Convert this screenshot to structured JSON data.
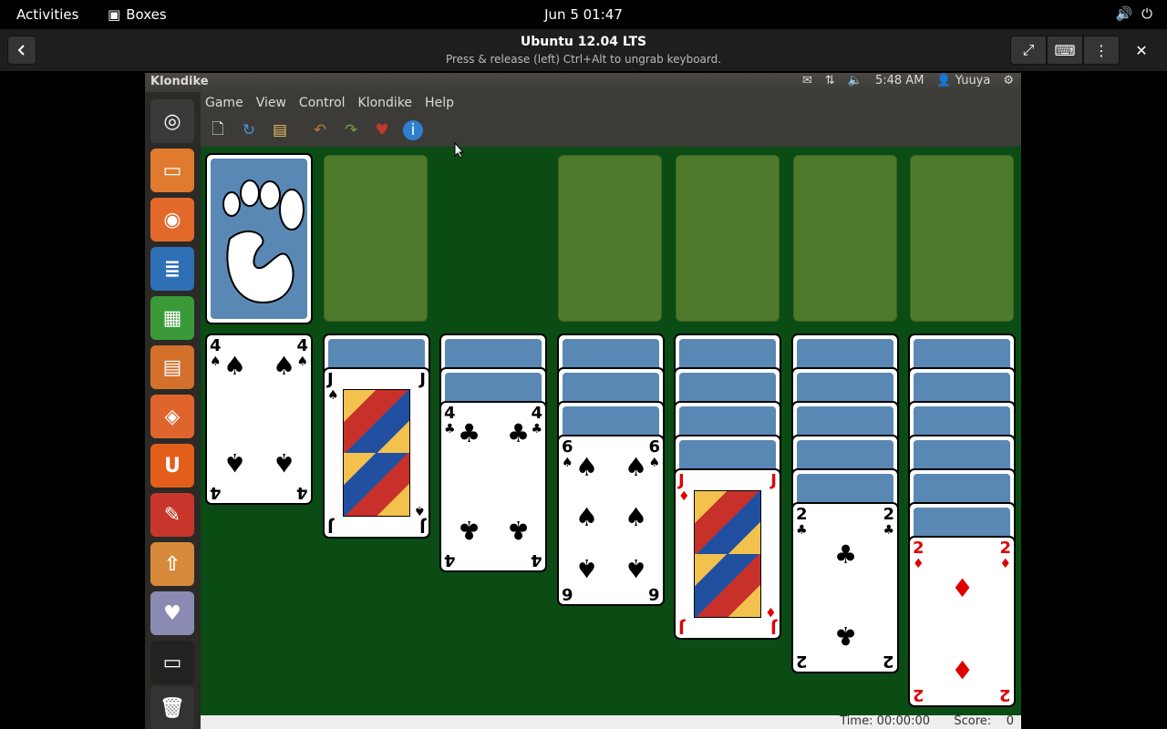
{
  "topbar": {
    "activities": "Activities",
    "app_name": "Boxes",
    "clock": "Jun 5  01:47"
  },
  "boxes": {
    "title": "Ubuntu 12.04 LTS",
    "subtitle": "Press & release (left) Ctrl+Alt to ungrab keyboard."
  },
  "ubuntu_panel": {
    "window_title": "Klondike",
    "time": "5:48 AM",
    "user": "Yuuya"
  },
  "menu": [
    "Game",
    "View",
    "Control",
    "Klondike",
    "Help"
  ],
  "toolbar_icons": [
    "new-game-icon",
    "restart-icon",
    "select-game-icon",
    "undo-icon",
    "redo-icon",
    "hint-icon",
    "info-icon"
  ],
  "status": {
    "time_label": "Time:",
    "time_value": "00:00:00",
    "score_label": "Score:",
    "score_value": "0"
  },
  "launcher_icons": [
    "ubuntu-dash-icon",
    "files-icon",
    "firefox-icon",
    "writer-icon",
    "calc-icon",
    "impress-icon",
    "software-center-icon",
    "ubuntu-one-icon",
    "system-settings-icon",
    "update-manager-icon",
    "solitaire-icon",
    "workspace-switcher-icon",
    "trash-icon"
  ],
  "tableau": [
    {
      "hidden": 0,
      "top": {
        "rank": "4",
        "suit": "♠",
        "color": "black"
      }
    },
    {
      "hidden": 1,
      "top": {
        "rank": "J",
        "suit": "♠",
        "color": "black"
      }
    },
    {
      "hidden": 2,
      "top": {
        "rank": "4",
        "suit": "♣",
        "color": "black"
      }
    },
    {
      "hidden": 3,
      "top": {
        "rank": "6",
        "suit": "♠",
        "color": "black"
      }
    },
    {
      "hidden": 4,
      "top": {
        "rank": "J",
        "suit": "♦",
        "color": "red"
      }
    },
    {
      "hidden": 5,
      "top": {
        "rank": "2",
        "suit": "♣",
        "color": "black"
      }
    },
    {
      "hidden": 6,
      "top": {
        "rank": "2",
        "suit": "♦",
        "color": "red"
      }
    }
  ],
  "colors": {
    "felt": "#0a4c14",
    "slot": "#4f7a2c",
    "card_back": "#5a88b5"
  }
}
